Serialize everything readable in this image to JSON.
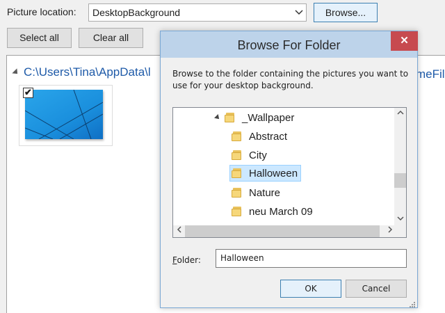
{
  "main": {
    "picture_location_label": "Picture location:",
    "picture_location_value": "DesktopBackground",
    "browse_label": "Browse...",
    "select_all_label": "Select all",
    "clear_all_label": "Clear all",
    "path_text": "C:\\Users\\Tina\\AppData\\l",
    "path_text_right": "meFil",
    "thumbnail_checked": true,
    "checkmark": "✔"
  },
  "dialog": {
    "title": "Browse For Folder",
    "close_glyph": "✕",
    "description": "Browse to the folder containing the pictures you want to use for your desktop background.",
    "tree": {
      "parent": "_Wallpaper",
      "items": [
        {
          "label": "Abstract",
          "selected": false
        },
        {
          "label": "City",
          "selected": false
        },
        {
          "label": "Halloween",
          "selected": true
        },
        {
          "label": "Nature",
          "selected": false
        },
        {
          "label": "neu March 09",
          "selected": false
        }
      ]
    },
    "folder_label_underlined": "F",
    "folder_label_rest": "older:",
    "folder_value": "Halloween",
    "ok_label": "OK",
    "cancel_label": "Cancel"
  },
  "colors": {
    "titlebar": "#bdd3ea",
    "close": "#c74a4f",
    "selection": "#cce8ff",
    "path_link": "#1e5aa8"
  }
}
